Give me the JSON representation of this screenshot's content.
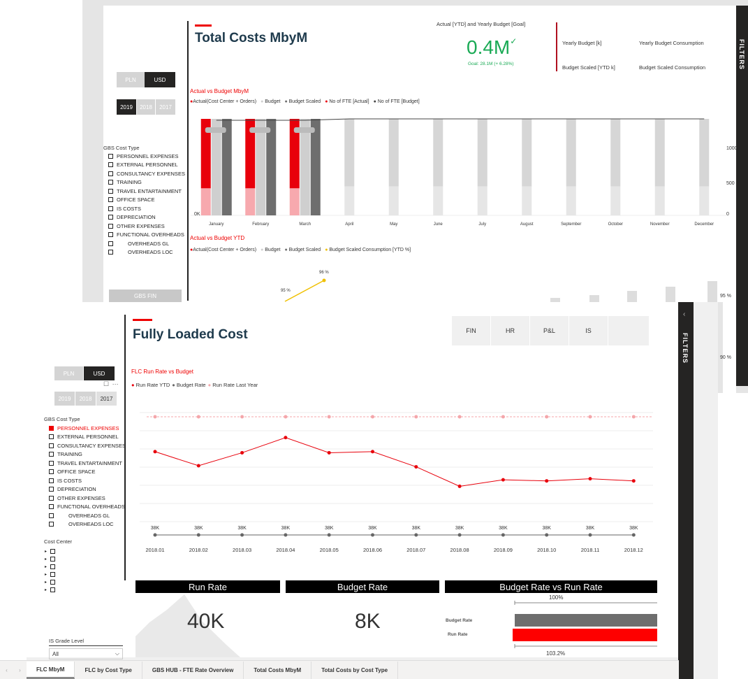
{
  "top_report": {
    "title": "Total Costs MbyM",
    "currency_buttons": [
      "PLN",
      "USD"
    ],
    "year_buttons": [
      "2019",
      "2018",
      "2017"
    ],
    "cost_type_header": "GBS Cost Type",
    "cost_types": [
      "PERSONNEL EXPENSES",
      "EXTERNAL PERSONNEL",
      "CONSULTANCY EXPENSES",
      "TRAINING",
      "TRAVEL ENTARTAINMENT",
      "OFFICE SPACE",
      "IS COSTS",
      "DEPRECIATION",
      "OTHER EXPENSES",
      "FUNCTIONAL OVERHEADS",
      "OVERHEADS GL",
      "OVERHEADS LOC"
    ],
    "gbs_fin_button": "GBS FIN",
    "kpi_title": "Actual [YTD] and Yearly Budget [Goal]",
    "kpi_value": "0.4M",
    "kpi_goal": "Goal: 28.1M (+ 6.28%)",
    "card_labels": [
      "Yearly Budget [k]",
      "Yearly Budget Consumption",
      "Budget Scaled [YTD k]",
      "Budget Scaled Consumption"
    ],
    "chart1_title": "Actual vs Budget MbyM",
    "chart1_legend": [
      "Actual(Cost Center + Orders)",
      "Budget",
      "Budget Scaled",
      "No of FTE [Actual]",
      "No of FTE [Budget]"
    ],
    "chart2_title": "Actual vs Budget YTD",
    "chart2_legend": [
      "Actual(Cost Center + Orders)",
      "Budget",
      "Budget Scaled",
      "Budget Scaled Consumption [YTD %]"
    ],
    "pct_labels": [
      "95 %",
      "96 %"
    ],
    "right_axis_labels": [
      "95 %",
      "90 %"
    ],
    "filters_label": "FILTERS"
  },
  "main_report": {
    "title": "Fully Loaded Cost",
    "nav_buttons": [
      "FIN",
      "HR",
      "P&L",
      "IS"
    ],
    "currency_buttons": [
      "PLN",
      "USD"
    ],
    "year_buttons": [
      "2019",
      "2018",
      "2017"
    ],
    "cost_type_header": "GBS Cost Type",
    "cost_types": [
      "PERSONNEL EXPENSES",
      "EXTERNAL PERSONNEL",
      "CONSULTANCY EXPENSES",
      "TRAINING",
      "TRAVEL ENTARTAINMENT",
      "OFFICE SPACE",
      "IS COSTS",
      "DEPRECIATION",
      "OTHER EXPENSES",
      "FUNCTIONAL OVERHEADS",
      "OVERHEADS GL",
      "OVERHEADS LOC"
    ],
    "cost_center_header": "Cost Center",
    "grade_level_header": "IS Grade Level",
    "grade_level_value": "All",
    "chart_title": "FLC Run Rate vs Budget",
    "chart_legend": [
      "Run Rate YTD",
      "Budget Rate",
      "Run Rate Last Year"
    ],
    "run_rate_header": "Run Rate",
    "run_rate_value": "40K",
    "budget_rate_header": "Budget Rate",
    "budget_rate_value": "8K",
    "comparison_header": "Budget Rate vs Run Rate",
    "comparison_top": "100%",
    "comparison_bottom": "103.2%",
    "comparison_labels": [
      "Budget Rate",
      "Run Rate"
    ],
    "filters_label": "FILTERS"
  },
  "tabs": [
    "FLC MbyM",
    "FLC by Cost Type",
    "GBS HUB - FTE Rate Overview",
    "Total Costs MbyM",
    "Total Costs by Cost Type"
  ],
  "chart_data": [
    {
      "type": "bar",
      "title": "Actual vs Budget MbyM",
      "categories": [
        "January",
        "February",
        "March",
        "April",
        "May",
        "June",
        "July",
        "August",
        "September",
        "October",
        "November",
        "December"
      ],
      "series": [
        {
          "name": "Actual(Cost Center + Orders)",
          "values": [
            1.0,
            1.0,
            1.0,
            null,
            null,
            null,
            null,
            null,
            null,
            null,
            null,
            null
          ]
        },
        {
          "name": "Budget",
          "values": [
            1.0,
            1.0,
            1.0,
            1.0,
            1.0,
            1.0,
            1.0,
            1.0,
            1.0,
            1.0,
            1.0,
            1.0
          ]
        },
        {
          "name": "Budget Scaled",
          "values": [
            1.0,
            1.0,
            1.0,
            null,
            null,
            null,
            null,
            null,
            null,
            null,
            null,
            null
          ]
        }
      ],
      "y_left_labels": [
        "0K"
      ],
      "y_right_labels": [
        "1000",
        "500",
        "0"
      ],
      "colors": {
        "actual": "#e8000b",
        "actual_light": "#f7a9ae",
        "budget": "#cfcfcf",
        "budget_scaled": "#6e6e6e"
      }
    },
    {
      "type": "line",
      "title": "FLC Run Rate vs Budget",
      "categories": [
        "2018.01",
        "2018.02",
        "2018.03",
        "2018.04",
        "2018.05",
        "2018.06",
        "2018.07",
        "2018.08",
        "2018.09",
        "2018.10",
        "2018.11",
        "2018.12"
      ],
      "series": [
        {
          "name": "Run Rate YTD",
          "values": [
            0.75,
            0.62,
            0.74,
            0.88,
            0.74,
            0.75,
            0.61,
            0.43,
            0.49,
            0.48,
            0.5,
            0.48
          ]
        },
        {
          "name": "Budget Rate",
          "values": [
            38,
            38,
            38,
            38,
            38,
            38,
            38,
            38,
            38,
            38,
            38,
            38
          ],
          "labels": [
            "38K",
            "38K",
            "38K",
            "38K",
            "38K",
            "38K",
            "38K",
            "38K",
            "38K",
            "38K",
            "38K",
            "38K"
          ]
        },
        {
          "name": "Run Rate Last Year",
          "values": [
            1,
            1,
            1,
            1,
            1,
            1,
            1,
            1,
            1,
            1,
            1,
            1
          ]
        }
      ],
      "colors": {
        "run_rate": "#e8000b",
        "budget_rate": "#666666",
        "last_year": "#f4a6aa"
      }
    },
    {
      "type": "bar",
      "title": "Budget Rate vs Run Rate",
      "categories": [
        "Budget Rate",
        "Run Rate"
      ],
      "values": [
        100,
        103.2
      ],
      "colors": {
        "budget": "#6e6e6e",
        "run": "#fe0000"
      }
    }
  ]
}
